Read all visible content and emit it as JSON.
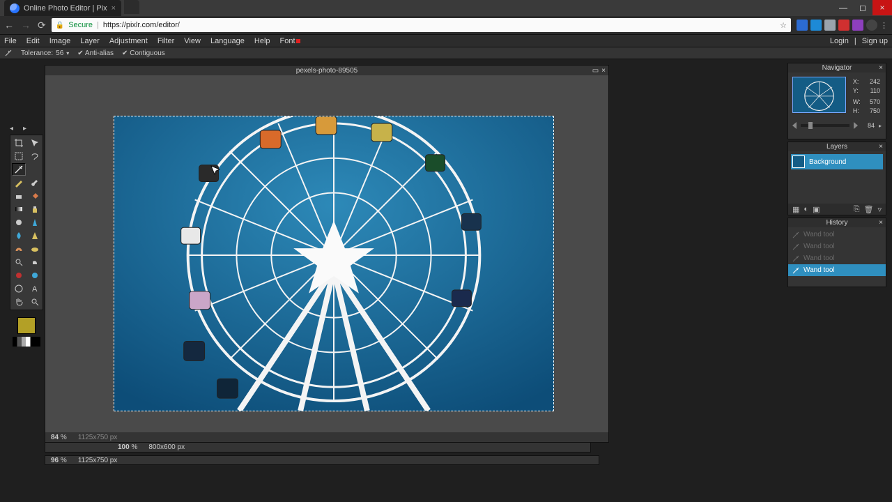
{
  "browser": {
    "tab_title": "Online Photo Editor | Pix",
    "secure_label": "Secure",
    "url": "https://pixlr.com/editor/",
    "extensions": [
      "#2c6bd1",
      "#1d8ad6",
      "#9aa3ad",
      "#d03030",
      "#8d3fbd"
    ]
  },
  "menu": {
    "items": [
      "File",
      "Edit",
      "Image",
      "Layer",
      "Adjustment",
      "Filter",
      "View",
      "Language",
      "Help",
      "Font"
    ],
    "login": "Login",
    "signup": "Sign up"
  },
  "options": {
    "tolerance_label": "Tolerance:",
    "tolerance_value": "56",
    "antialias": "Anti-alias",
    "contiguous": "Contiguous"
  },
  "document": {
    "title": "pexels-photo-89505",
    "zoom": "84",
    "zoom_pct_sym": "%",
    "dimensions": "1125x750 px",
    "zoom2": "100",
    "dims2": "800x600 px",
    "footer_zoom": "96",
    "footer_dims": "1125x750 px"
  },
  "navigator": {
    "title": "Navigator",
    "readout": {
      "X": "242",
      "Y": "110",
      "W": "570",
      "H": "750"
    },
    "zoom_value": "84"
  },
  "layers": {
    "title": "Layers",
    "row": "Background"
  },
  "history": {
    "title": "History",
    "items": [
      "Wand tool",
      "Wand tool",
      "Wand tool",
      "Wand tool"
    ],
    "active_index": 3
  },
  "colors": {
    "canvas_bg": "#4a4a4a",
    "panel_bg": "#343434",
    "accent": "#2f8fbf",
    "sky": "#145c85",
    "swatch": "#b3a026"
  },
  "icons": {
    "tools": [
      "crop",
      "move",
      "marquee",
      "lasso",
      "wand",
      "",
      "pencil",
      "brush",
      "eraser",
      "paintbucket",
      "gradient",
      "clone",
      "blur",
      "sharpen",
      "smudge",
      "sponge",
      "dodge",
      "burn",
      "redeye",
      "spot",
      "bloat",
      "pinch",
      "colorpick",
      "text",
      "hand",
      "zoom"
    ]
  }
}
